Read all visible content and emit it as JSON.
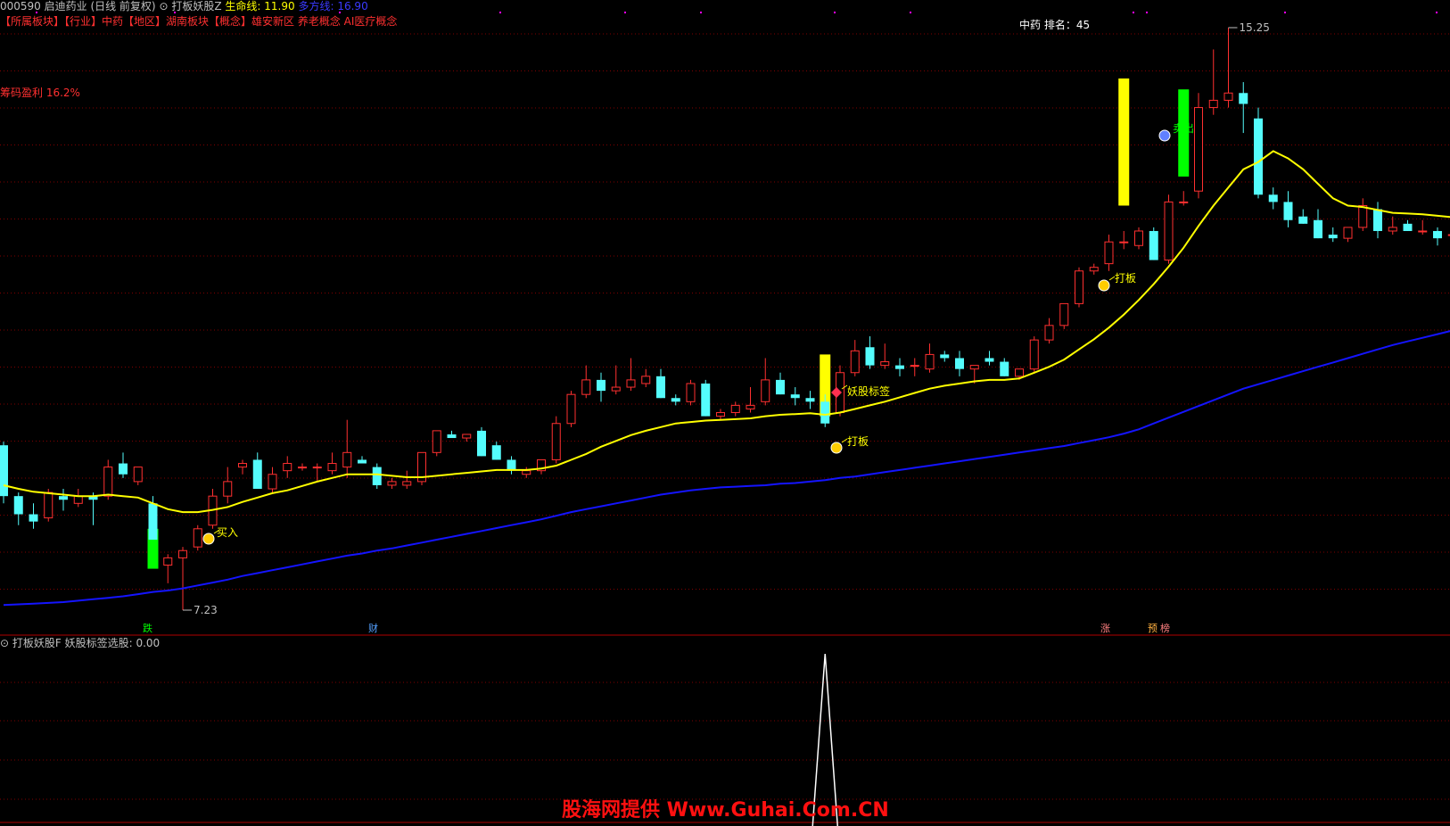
{
  "header": {
    "stock": "000590 启迪药业 (日线 前复权)",
    "indicator_name": "打板妖股Z",
    "shengming_label": "生命线:",
    "shengming_value": "11.90",
    "duofang_label": "多方线:",
    "duofang_value": "16.90"
  },
  "tags": "【所属板块】【行业】中药【地区】湖南板块【概念】雄安新区 养老概念 AI医疗概念",
  "profit_text": "筹码盈利 16.2%",
  "ranking": "中药  排名：45",
  "signals": {
    "buy": "买入",
    "daban": "打板",
    "yaogu": "妖股标签",
    "sell": "卖出"
  },
  "bottom_labels": [
    "跌",
    "财",
    "涨",
    "预",
    "榜"
  ],
  "sub_header": "打板妖股F  妖股标签选股: 0.00",
  "watermark": "股海网提供 Www.Guhai.Com.CN",
  "colors": {
    "up": "#ff3030",
    "down": "#54fcfc",
    "ma_life": "#ffff00",
    "ma_long": "#1414ff",
    "grid": "#800000"
  },
  "chart_data": {
    "type": "candlestick",
    "ymin_label": "7.23",
    "ymax_label": "15.25",
    "low": 7.23,
    "high": 15.25,
    "ohlc": [
      [
        9.5,
        9.55,
        8.7,
        8.8
      ],
      [
        8.8,
        8.85,
        8.4,
        8.55
      ],
      [
        8.55,
        8.7,
        8.35,
        8.45
      ],
      [
        8.5,
        8.9,
        8.45,
        8.85
      ],
      [
        8.8,
        8.9,
        8.6,
        8.75
      ],
      [
        8.7,
        8.9,
        8.65,
        8.8
      ],
      [
        8.8,
        8.85,
        8.4,
        8.75
      ],
      [
        8.8,
        9.3,
        8.75,
        9.2
      ],
      [
        9.25,
        9.4,
        9.05,
        9.1
      ],
      [
        9.0,
        9.2,
        8.95,
        9.2
      ],
      [
        8.7,
        8.8,
        8.2,
        8.2
      ],
      [
        7.85,
        8.0,
        7.6,
        7.95
      ],
      [
        7.95,
        8.1,
        7.23,
        8.05
      ],
      [
        8.1,
        8.4,
        8.05,
        8.35
      ],
      [
        8.4,
        8.9,
        8.35,
        8.8
      ],
      [
        8.8,
        9.2,
        8.7,
        9.0
      ],
      [
        9.2,
        9.3,
        9.1,
        9.25
      ],
      [
        9.3,
        9.4,
        8.9,
        8.9
      ],
      [
        8.9,
        9.2,
        8.85,
        9.1
      ],
      [
        9.15,
        9.35,
        9.05,
        9.25
      ],
      [
        9.2,
        9.25,
        9.15,
        9.2
      ],
      [
        9.2,
        9.25,
        9.0,
        9.2
      ],
      [
        9.15,
        9.4,
        9.1,
        9.25
      ],
      [
        9.2,
        9.85,
        9.05,
        9.4
      ],
      [
        9.3,
        9.35,
        9.25,
        9.25
      ],
      [
        9.2,
        9.25,
        8.9,
        8.95
      ],
      [
        8.95,
        9.05,
        8.9,
        9.0
      ],
      [
        8.95,
        9.15,
        8.9,
        9.0
      ],
      [
        9.0,
        9.4,
        8.95,
        9.4
      ],
      [
        9.4,
        9.7,
        9.35,
        9.7
      ],
      [
        9.65,
        9.7,
        9.6,
        9.6
      ],
      [
        9.6,
        9.65,
        9.55,
        9.65
      ],
      [
        9.7,
        9.75,
        9.35,
        9.35
      ],
      [
        9.5,
        9.55,
        9.3,
        9.3
      ],
      [
        9.3,
        9.35,
        9.1,
        9.15
      ],
      [
        9.1,
        9.2,
        9.05,
        9.15
      ],
      [
        9.15,
        9.3,
        9.1,
        9.3
      ],
      [
        9.3,
        9.9,
        9.25,
        9.8
      ],
      [
        9.8,
        10.25,
        9.75,
        10.2
      ],
      [
        10.2,
        10.6,
        10.15,
        10.4
      ],
      [
        10.4,
        10.5,
        10.1,
        10.25
      ],
      [
        10.25,
        10.6,
        10.2,
        10.3
      ],
      [
        10.3,
        10.7,
        10.25,
        10.4
      ],
      [
        10.35,
        10.55,
        10.3,
        10.45
      ],
      [
        10.45,
        10.55,
        10.15,
        10.15
      ],
      [
        10.15,
        10.2,
        10.05,
        10.1
      ],
      [
        10.1,
        10.4,
        10.05,
        10.35
      ],
      [
        10.35,
        10.4,
        9.9,
        9.9
      ],
      [
        9.9,
        10.0,
        9.85,
        9.95
      ],
      [
        9.95,
        10.1,
        9.9,
        10.05
      ],
      [
        10.0,
        10.3,
        9.95,
        10.05
      ],
      [
        10.1,
        10.7,
        10.05,
        10.4
      ],
      [
        10.4,
        10.5,
        10.2,
        10.2
      ],
      [
        10.2,
        10.3,
        10.05,
        10.15
      ],
      [
        10.15,
        10.25,
        10.0,
        10.1
      ],
      [
        10.1,
        10.2,
        9.75,
        9.8
      ],
      [
        9.95,
        10.6,
        9.9,
        10.5
      ],
      [
        10.5,
        10.95,
        10.45,
        10.8
      ],
      [
        10.85,
        11.0,
        10.55,
        10.6
      ],
      [
        10.6,
        10.9,
        10.55,
        10.65
      ],
      [
        10.6,
        10.7,
        10.45,
        10.55
      ],
      [
        10.6,
        10.7,
        10.45,
        10.6
      ],
      [
        10.55,
        10.9,
        10.5,
        10.75
      ],
      [
        10.75,
        10.8,
        10.65,
        10.7
      ],
      [
        10.7,
        10.8,
        10.45,
        10.55
      ],
      [
        10.55,
        10.6,
        10.35,
        10.6
      ],
      [
        10.7,
        10.8,
        10.6,
        10.65
      ],
      [
        10.65,
        10.7,
        10.45,
        10.45
      ],
      [
        10.45,
        10.55,
        10.4,
        10.55
      ],
      [
        10.55,
        11.0,
        10.5,
        10.95
      ],
      [
        10.95,
        11.25,
        10.9,
        11.15
      ],
      [
        11.15,
        11.45,
        11.1,
        11.45
      ],
      [
        11.45,
        11.95,
        11.4,
        11.9
      ],
      [
        11.9,
        12.0,
        11.85,
        11.95
      ],
      [
        12.0,
        12.4,
        11.9,
        12.3
      ],
      [
        12.3,
        12.45,
        12.2,
        12.3
      ],
      [
        12.25,
        12.5,
        12.2,
        12.45
      ],
      [
        12.45,
        12.5,
        12.05,
        12.05
      ],
      [
        12.05,
        12.95,
        12.0,
        12.85
      ],
      [
        12.85,
        13.0,
        12.8,
        12.85
      ],
      [
        13.0,
        14.35,
        12.9,
        14.15
      ],
      [
        14.15,
        14.95,
        14.05,
        14.25
      ],
      [
        14.25,
        15.25,
        14.15,
        14.35
      ],
      [
        14.35,
        14.5,
        13.8,
        14.2
      ],
      [
        14.0,
        14.15,
        12.9,
        12.95
      ],
      [
        12.95,
        13.05,
        12.75,
        12.85
      ],
      [
        12.85,
        13.0,
        12.5,
        12.6
      ],
      [
        12.65,
        12.75,
        12.55,
        12.55
      ],
      [
        12.6,
        12.75,
        12.35,
        12.35
      ],
      [
        12.4,
        12.5,
        12.3,
        12.35
      ],
      [
        12.35,
        12.5,
        12.3,
        12.5
      ],
      [
        12.5,
        12.9,
        12.45,
        12.8
      ],
      [
        12.75,
        12.85,
        12.35,
        12.45
      ],
      [
        12.45,
        12.65,
        12.4,
        12.5
      ],
      [
        12.55,
        12.6,
        12.45,
        12.45
      ],
      [
        12.45,
        12.6,
        12.4,
        12.45
      ],
      [
        12.45,
        12.5,
        12.25,
        12.35
      ],
      [
        12.4,
        12.45,
        12.3,
        12.4
      ],
      [
        12.35,
        12.45,
        12.3,
        12.4
      ],
      [
        12.35,
        12.5,
        12.2,
        12.3
      ]
    ],
    "ma_life": [
      8.95,
      8.9,
      8.86,
      8.84,
      8.82,
      8.8,
      8.8,
      8.82,
      8.8,
      8.78,
      8.7,
      8.62,
      8.58,
      8.58,
      8.61,
      8.65,
      8.72,
      8.78,
      8.84,
      8.88,
      8.94,
      9.0,
      9.05,
      9.1,
      9.1,
      9.1,
      9.08,
      9.06,
      9.06,
      9.08,
      9.1,
      9.12,
      9.14,
      9.16,
      9.16,
      9.16,
      9.18,
      9.22,
      9.3,
      9.38,
      9.48,
      9.56,
      9.64,
      9.7,
      9.75,
      9.8,
      9.82,
      9.84,
      9.85,
      9.86,
      9.87,
      9.9,
      9.92,
      9.93,
      9.94,
      9.92,
      9.95,
      10.0,
      10.05,
      10.1,
      10.16,
      10.22,
      10.28,
      10.32,
      10.35,
      10.38,
      10.4,
      10.4,
      10.42,
      10.5,
      10.58,
      10.68,
      10.82,
      10.96,
      11.12,
      11.3,
      11.5,
      11.72,
      11.96,
      12.22,
      12.52,
      12.8,
      13.05,
      13.3,
      13.4,
      13.55,
      13.45,
      13.3,
      13.1,
      12.9,
      12.8,
      12.78,
      12.74,
      12.7,
      12.69,
      12.68,
      12.66,
      12.64,
      12.6,
      12.55
    ],
    "ma_long": [
      7.3,
      7.31,
      7.32,
      7.33,
      7.34,
      7.36,
      7.38,
      7.4,
      7.42,
      7.45,
      7.48,
      7.5,
      7.53,
      7.57,
      7.61,
      7.65,
      7.7,
      7.74,
      7.78,
      7.82,
      7.86,
      7.9,
      7.94,
      7.98,
      8.01,
      8.05,
      8.08,
      8.12,
      8.16,
      8.2,
      8.24,
      8.28,
      8.32,
      8.36,
      8.4,
      8.44,
      8.48,
      8.53,
      8.58,
      8.62,
      8.66,
      8.7,
      8.74,
      8.78,
      8.82,
      8.85,
      8.88,
      8.9,
      8.92,
      8.93,
      8.94,
      8.95,
      8.97,
      8.98,
      9.0,
      9.02,
      9.05,
      9.07,
      9.1,
      9.13,
      9.16,
      9.19,
      9.22,
      9.25,
      9.28,
      9.31,
      9.34,
      9.37,
      9.4,
      9.43,
      9.46,
      9.49,
      9.53,
      9.57,
      9.61,
      9.66,
      9.72,
      9.8,
      9.88,
      9.96,
      10.04,
      10.12,
      10.2,
      10.28,
      10.34,
      10.4,
      10.46,
      10.52,
      10.58,
      10.64,
      10.7,
      10.76,
      10.82,
      10.88,
      10.93,
      10.98,
      11.03,
      11.08,
      11.13,
      11.18
    ],
    "bars": [
      {
        "i": 10,
        "from": 7.8,
        "to": 8.35,
        "color": "#00ff00"
      },
      {
        "i": 55,
        "from": 9.9,
        "to": 10.75,
        "color": "#ffff00"
      },
      {
        "i": 75,
        "from": 12.8,
        "to": 14.55,
        "color": "#ffff00"
      },
      {
        "i": 79,
        "from": 13.2,
        "to": 14.4,
        "color": "#00ff00"
      }
    ],
    "sub_spike_index": 55
  }
}
